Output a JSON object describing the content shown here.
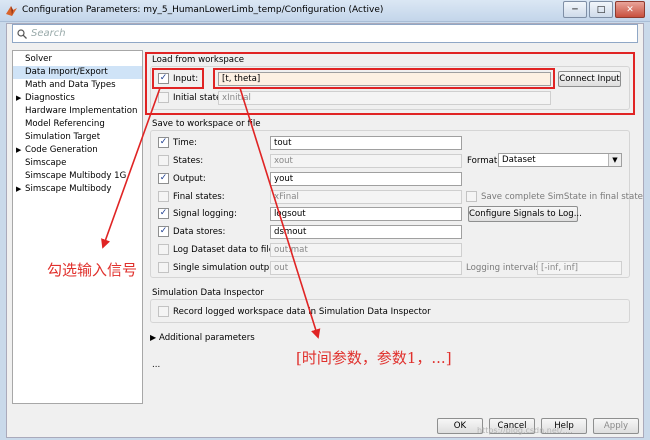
{
  "window": {
    "title": "Configuration Parameters: my_5_HumanLowerLimb_temp/Configuration (Active)",
    "minimize_glyph": "─",
    "maximize_glyph": "□",
    "close_glyph": "✕"
  },
  "search": {
    "placeholder": "Search"
  },
  "sidebar": {
    "items": [
      {
        "label": "Solver",
        "expandable": false,
        "selected": false
      },
      {
        "label": "Data Import/Export",
        "expandable": false,
        "selected": true
      },
      {
        "label": "Math and Data Types",
        "expandable": false,
        "selected": false
      },
      {
        "label": "Diagnostics",
        "expandable": true,
        "selected": false
      },
      {
        "label": "Hardware Implementation",
        "expandable": false,
        "selected": false
      },
      {
        "label": "Model Referencing",
        "expandable": false,
        "selected": false
      },
      {
        "label": "Simulation Target",
        "expandable": false,
        "selected": false
      },
      {
        "label": "Code Generation",
        "expandable": true,
        "selected": false
      },
      {
        "label": "Simscape",
        "expandable": false,
        "selected": false
      },
      {
        "label": "Simscape Multibody 1G",
        "expandable": false,
        "selected": false
      },
      {
        "label": "Simscape Multibody",
        "expandable": true,
        "selected": false
      }
    ]
  },
  "load": {
    "title": "Load from workspace",
    "input_label": "Input:",
    "input_checked": true,
    "input_value": "[t, theta]",
    "connect_button": "Connect Input",
    "initial_state_label": "Initial state:",
    "initial_state_checked": false,
    "initial_state_value": "xInitial"
  },
  "save": {
    "title": "Save to workspace or file",
    "time_label": "Time:",
    "time_value": "tout",
    "time_checked": true,
    "states_label": "States:",
    "states_value": "xout",
    "states_checked": false,
    "format_label": "Format:",
    "format_value": "Dataset",
    "output_label": "Output:",
    "output_value": "yout",
    "output_checked": true,
    "final_label": "Final states:",
    "final_value": "xFinal",
    "final_checked": false,
    "complete_label": "Save complete SimState in final state",
    "siglog_label": "Signal logging:",
    "siglog_value": "logsout",
    "siglog_checked": true,
    "configure_button": "Configure Signals to Log...",
    "datastores_label": "Data stores:",
    "datastores_value": "dsmout",
    "datastores_checked": true,
    "logfile_label": "Log Dataset data to file:",
    "logfile_value": "out.mat",
    "logfile_checked": false,
    "single_label": "Single simulation output:",
    "single_value": "out",
    "single_checked": false,
    "interval_label": "Logging intervals:",
    "interval_value": "[-inf, inf]"
  },
  "sdi": {
    "title": "Simulation Data Inspector",
    "record_label": "Record logged workspace data in Simulation Data Inspector",
    "record_checked": false
  },
  "additional_label": "Additional parameters",
  "ellipsis": "...",
  "footer": {
    "ok": "OK",
    "cancel": "Cancel",
    "help": "Help",
    "apply": "Apply",
    "watermark": "https://blog.csdn.net/...."
  },
  "annotations": {
    "check_input": "勾选输入信号",
    "params": "[时间参数，参数1，...]"
  },
  "colors": {
    "annotation": "#e02424",
    "selection": "#cfe3f7",
    "titlebar": "#c3d5ea"
  }
}
